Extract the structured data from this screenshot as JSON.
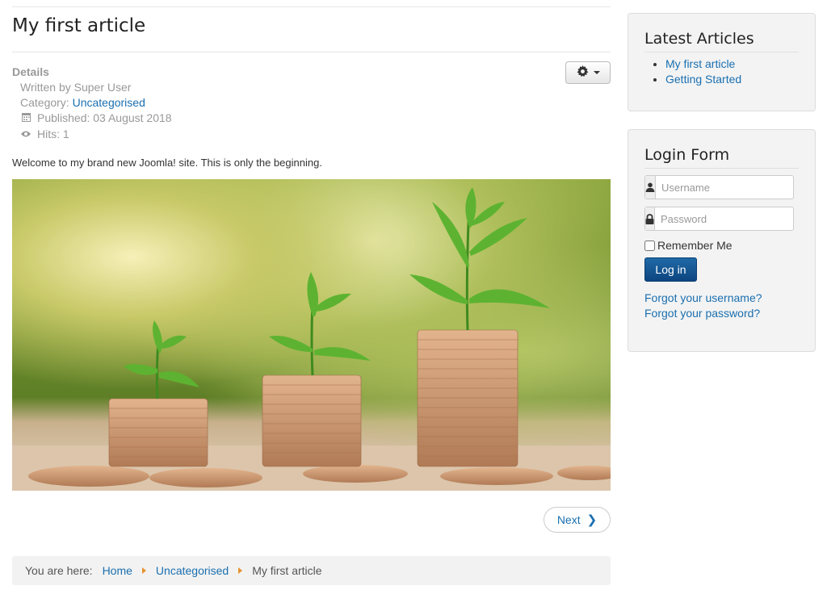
{
  "article": {
    "title": "My first article",
    "details_label": "Details",
    "written_by": "Written by Super User",
    "category_label": "Category:",
    "category_link": "Uncategorised",
    "published": "Published: 03 August 2018",
    "hits": "Hits: 1",
    "intro": "Welcome to my brand new Joomla! site. This is only the beginning.",
    "next_label": "Next"
  },
  "breadcrumb": {
    "prefix": "You are here:",
    "items": [
      "Home",
      "Uncategorised",
      "My first article"
    ]
  },
  "latest_articles": {
    "title": "Latest Articles",
    "items": [
      "My first article",
      "Getting Started"
    ]
  },
  "login_form": {
    "title": "Login Form",
    "username_placeholder": "Username",
    "password_placeholder": "Password",
    "remember_label": "Remember Me",
    "login_label": "Log in",
    "forgot_username": "Forgot your username?",
    "forgot_password": "Forgot your password?"
  },
  "icons": {
    "tools": "gear-icon",
    "published": "calendar-icon",
    "hits": "eye-icon",
    "user": "user-icon",
    "password": "lock-icon",
    "next": "chevron-right-icon",
    "breadcrumb_separator": "caret-right-icon"
  },
  "colors": {
    "link": "#1a6fb0",
    "login_button": "#0d4580",
    "breadcrumb_separator": "#e6902e",
    "module_bg": "#f3f3f3"
  }
}
